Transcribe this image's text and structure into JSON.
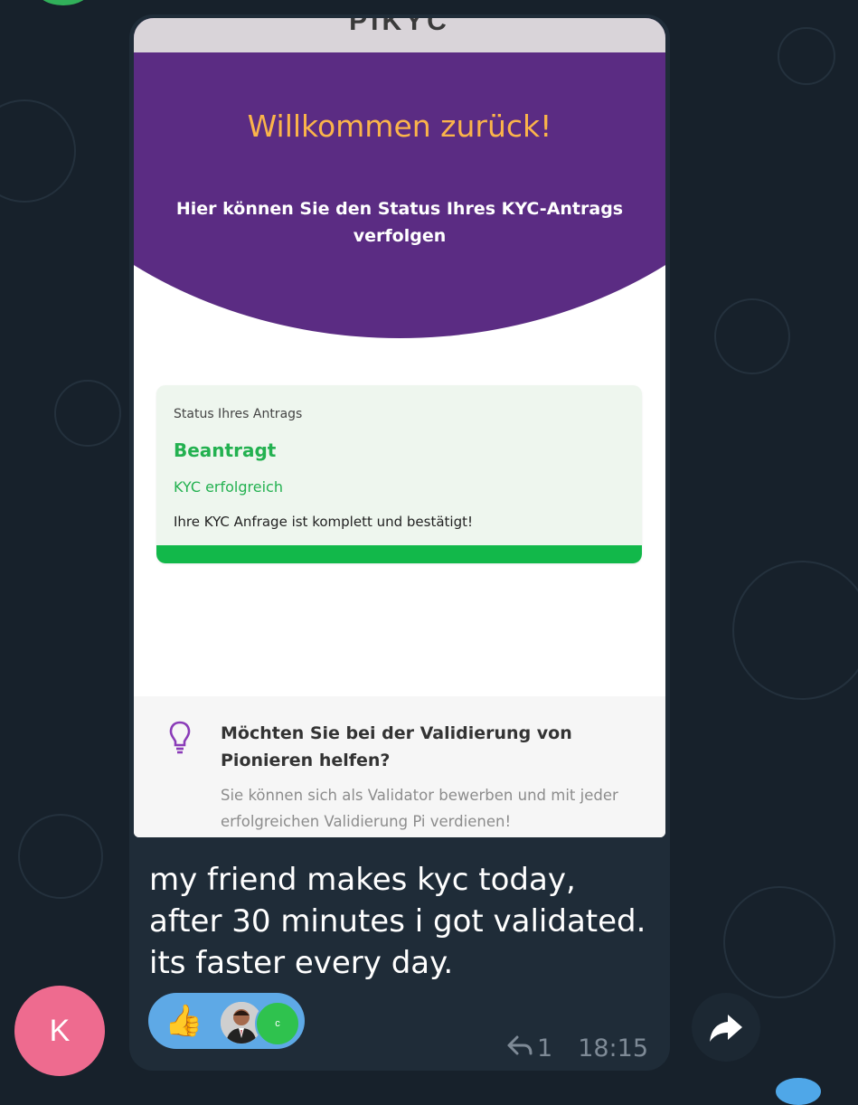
{
  "screenshot": {
    "title_fragment": "PIKYC",
    "hero_title": "Willkommen zurück!",
    "hero_subtitle": "Hier können Sie den Status Ihres KYC-Antrags verfolgen",
    "status_card": {
      "label": "Status Ihres Antrags",
      "state": "Beantragt",
      "kyc_result": "KYC erfolgreich",
      "description": "Ihre KYC Anfrage ist komplett und bestätigt!",
      "progress_fraction": 1.0
    },
    "validator": {
      "icon": "lightbulb-icon",
      "title": "Möchten Sie bei der Validierung von Pionieren helfen?",
      "description": "Sie können sich als Validator bewerben und mit jeder erfolgreichen Validierung Pi verdienen!"
    }
  },
  "message": {
    "text": "my friend makes kyc today, after 30 minutes i got validated. its faster every day.",
    "reactions": {
      "emoji": "👍",
      "reactor_initial": "c"
    },
    "reply_count": "1",
    "time": "18:15"
  },
  "sender": {
    "initial": "K",
    "color": "#ee6b8f"
  },
  "colors": {
    "background": "#17212b",
    "bubble": "#1f2c38",
    "hero_purple": "#5b2c83",
    "hero_title": "#fbb44a",
    "success_green": "#12b84a",
    "reaction_blue": "#5ea9e6"
  }
}
